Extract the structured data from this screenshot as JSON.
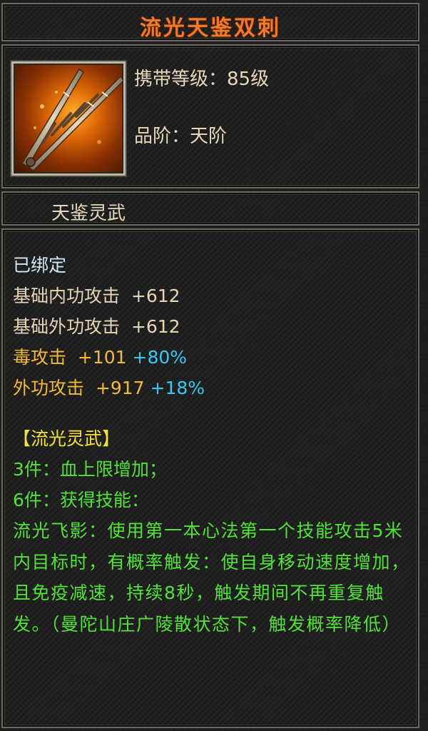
{
  "title": "流光天鉴双刺",
  "header": {
    "level_label": "携带等级：",
    "level_value": "85级",
    "grade_label": "品阶：",
    "grade_value": "天阶",
    "icon": "twin-daggers-icon"
  },
  "item_name": "天鉴灵武",
  "bound": "已绑定",
  "stats": [
    {
      "label": "基础内功攻击",
      "value": "+612"
    },
    {
      "label": "基础外功攻击",
      "value": "+612"
    },
    {
      "label": "毒攻击",
      "value": "+101",
      "bonus": "+80%"
    },
    {
      "label": "外功攻击",
      "value": "+917",
      "bonus": "+18%"
    }
  ],
  "set": {
    "name": "【流光灵武】",
    "piece3": "3件：血上限增加；",
    "piece6": "6件：获得技能：",
    "skill_text": "流光飞影：使用第一本心法第一个技能攻击5米内目标时，有概率触发：使自身移动速度增加，且免疫减速，持续8秒，触发期间不再重复触发。（曼陀山庄广陵散状态下，触发概率降低）"
  },
  "colors": {
    "title": "#f07a2a",
    "base_text": "#e6d6b6",
    "gold": "#f2b93c",
    "cyan": "#38c8f0",
    "yellow": "#f4e23a",
    "green": "#52e23a",
    "bound": "#cfe8f6"
  }
}
